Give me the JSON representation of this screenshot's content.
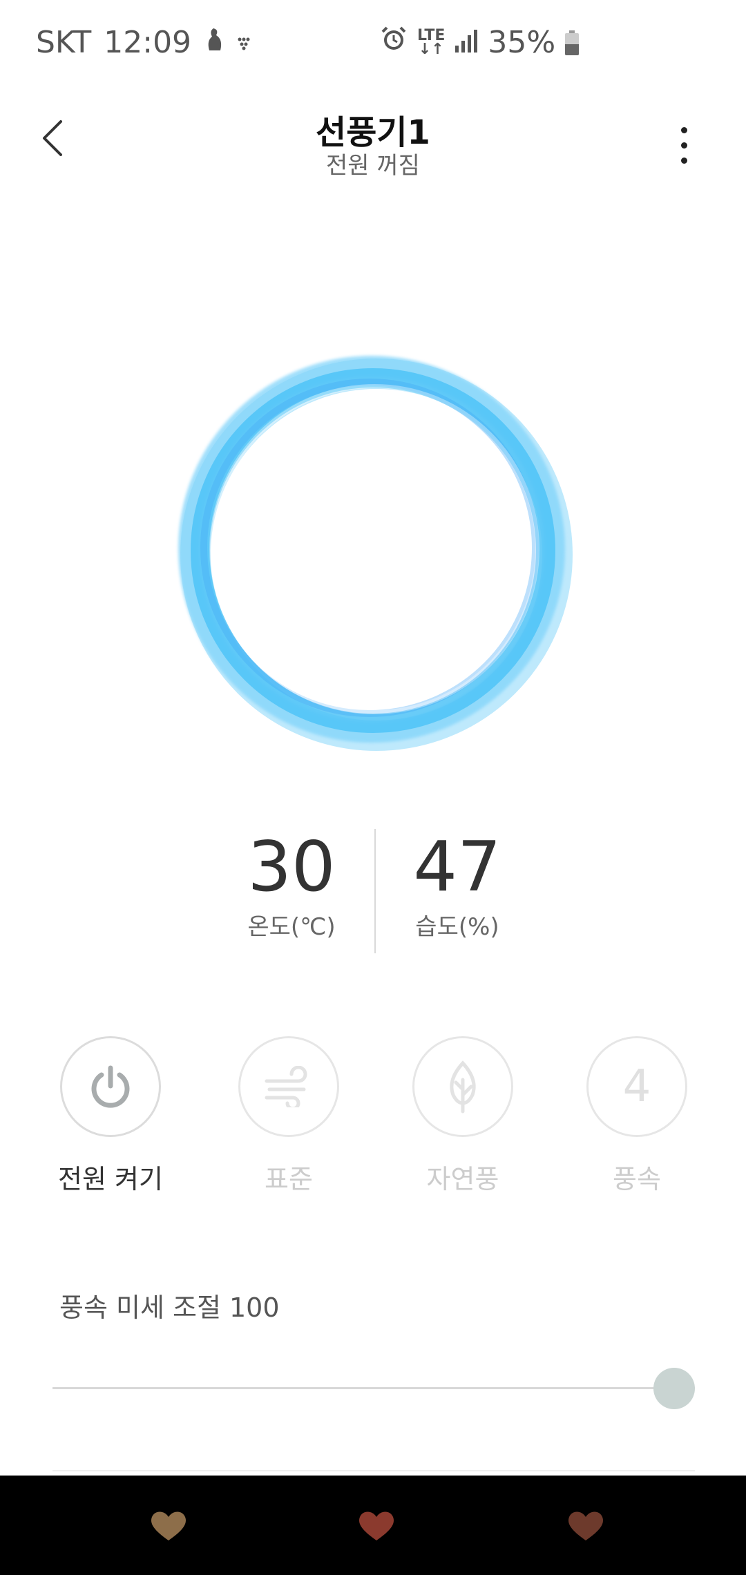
{
  "status_bar": {
    "carrier": "SKT",
    "time": "12:09",
    "network": "LTE",
    "battery": "35%",
    "icons": [
      "notification-icon",
      "dots-icon",
      "alarm-icon",
      "lte-data-icon",
      "signal-icon",
      "battery-icon"
    ]
  },
  "header": {
    "title": "선풍기1",
    "subtitle": "전원 꺼짐"
  },
  "readings": {
    "temperature": {
      "value": "30",
      "label": "온도(℃)"
    },
    "humidity": {
      "value": "47",
      "label": "습도(%)"
    }
  },
  "controls": {
    "power": {
      "label": "전원 켜기",
      "icon": "power-icon"
    },
    "mode": {
      "label": "표준",
      "icon": "wind-icon"
    },
    "natural": {
      "label": "자연풍",
      "icon": "leaf-icon"
    },
    "speed": {
      "label": "풍속",
      "value": "4"
    }
  },
  "fine_tuning": {
    "label": "풍속 미세 조절 100",
    "value": 100,
    "max": 100
  },
  "nav_bar": {
    "icons": [
      "heart-icon-left",
      "heart-icon-center",
      "heart-icon-right"
    ]
  },
  "colors": {
    "ring": "#4fc3f7",
    "ring_light": "#b3e5fc",
    "thumb": "#c9d4d2",
    "nav_heart_1": "#8d6e4a",
    "nav_heart_2": "#8b3a2e",
    "nav_heart_3": "#6d3a2c"
  }
}
